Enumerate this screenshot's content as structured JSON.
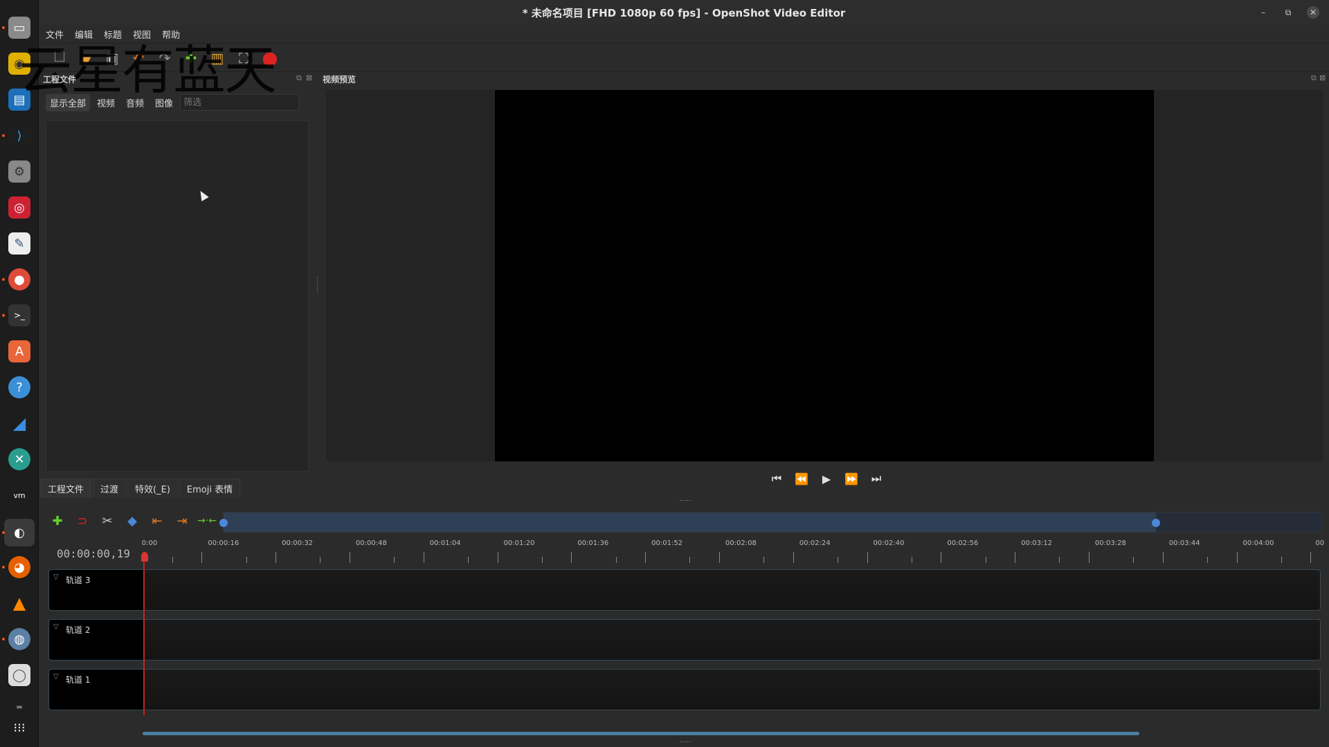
{
  "window": {
    "title": "* 未命名项目 [FHD 1080p 60 fps] - OpenShot Video Editor"
  },
  "watermark": "云星有蓝天",
  "menu": [
    "文件",
    "编辑",
    "标题",
    "视图",
    "帮助"
  ],
  "project_panel": {
    "title": "工程文件",
    "filters": [
      "显示全部",
      "视频",
      "音频",
      "图像"
    ],
    "filter_placeholder": "筛选"
  },
  "bottom_tabs": [
    "工程文件",
    "过渡",
    "特效(_E)",
    "Emoji 表情"
  ],
  "preview": {
    "title": "视频预览"
  },
  "timeline": {
    "timecode": "00:00:00,19",
    "ticks": [
      "0:00",
      "00:00:16",
      "00:00:32",
      "00:00:48",
      "00:01:04",
      "00:01:20",
      "00:01:36",
      "00:01:52",
      "00:02:08",
      "00:02:24",
      "00:02:40",
      "00:02:56",
      "00:03:12",
      "00:03:28",
      "00:03:44",
      "00:04:00",
      "00"
    ],
    "tracks": [
      "轨道 3",
      "轨道 2",
      "轨道 1"
    ]
  },
  "colors": {
    "accent": "#4a88d9",
    "playhead": "#cc2222",
    "dock": "#1d1d1d"
  }
}
